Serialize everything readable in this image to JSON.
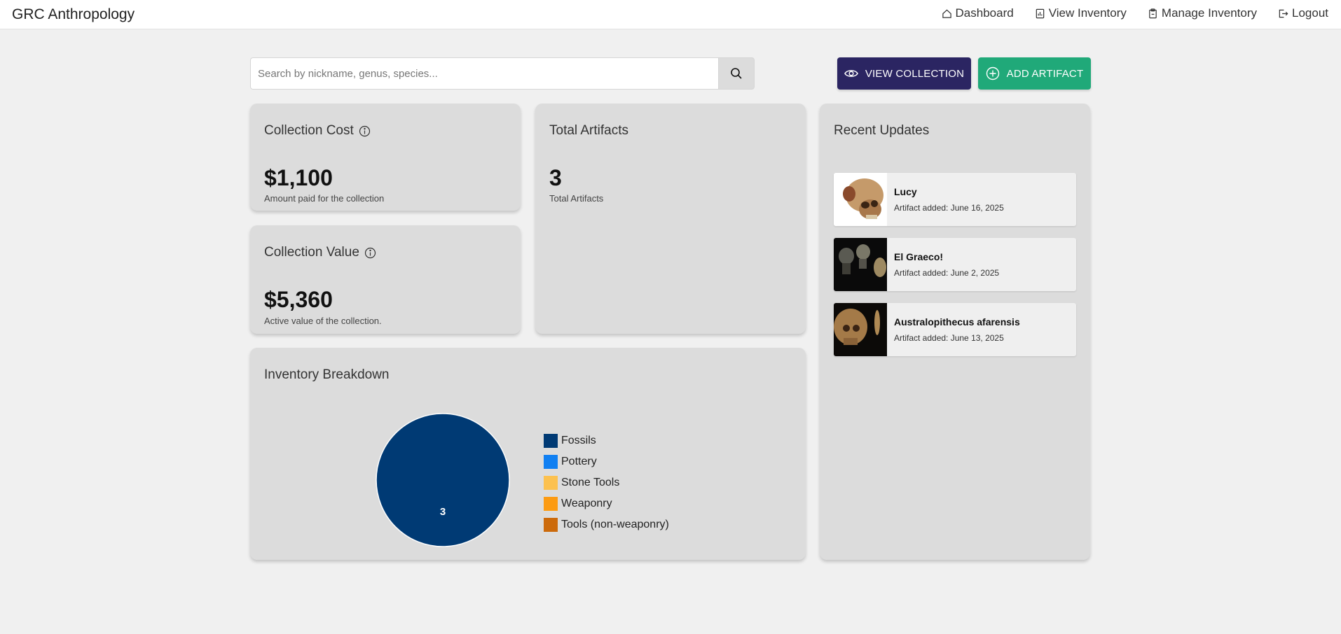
{
  "header": {
    "brand": "GRC Anthropology",
    "nav": [
      {
        "label": "Dashboard",
        "icon": "home-icon"
      },
      {
        "label": "View Inventory",
        "icon": "chart-icon"
      },
      {
        "label": "Manage Inventory",
        "icon": "clipboard-icon"
      },
      {
        "label": "Logout",
        "icon": "logout-icon"
      }
    ]
  },
  "search": {
    "placeholder": "Search by nickname, genus, species...",
    "value": ""
  },
  "actions": {
    "view_collection": "VIEW COLLECTION",
    "add_artifact": "ADD ARTIFACT",
    "view_color": "#2b2562",
    "add_color": "#20a979"
  },
  "cost_card": {
    "title": "Collection Cost",
    "value": "$1,100",
    "subtitle": "Amount paid for the collection"
  },
  "value_card": {
    "title": "Collection Value",
    "value": "$5,360",
    "subtitle": "Active value of the collection."
  },
  "artifacts_card": {
    "title": "Total Artifacts",
    "value": "3",
    "subtitle": "Total Artifacts"
  },
  "updates": {
    "title": "Recent Updates",
    "items": [
      {
        "name": "Lucy",
        "date": "Artifact added: June 16, 2025"
      },
      {
        "name": "El Graeco!",
        "date": "Artifact added: June 2, 2025"
      },
      {
        "name": "Australopithecus afarensis",
        "date": "Artifact added: June 13, 2025"
      }
    ]
  },
  "breakdown": {
    "title": "Inventory Breakdown"
  },
  "chart_data": {
    "type": "pie",
    "categories": [
      "Fossils",
      "Pottery",
      "Stone Tools",
      "Weaponry",
      "Tools (non-weaponry)"
    ],
    "values": [
      3,
      0,
      0,
      0,
      0
    ],
    "colors": [
      "#003a74",
      "#1180f2",
      "#fcc14f",
      "#fc9b12",
      "#cc6a0b"
    ],
    "slice_labels": [
      "3"
    ],
    "legend_position": "right"
  }
}
